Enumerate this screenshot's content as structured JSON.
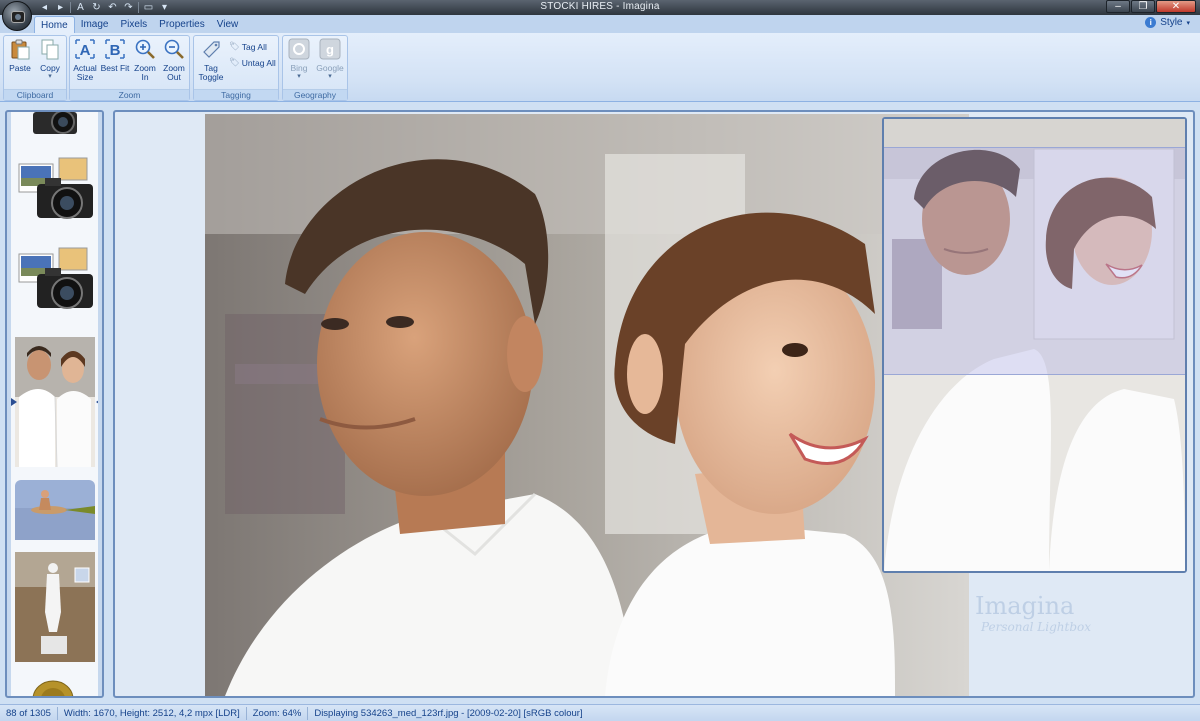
{
  "window": {
    "title": "STOCKI HIRES - Imagina"
  },
  "qat": {
    "icons": [
      "back-icon",
      "forward-icon",
      "text-a-icon",
      "rotate-cw-icon",
      "undo-icon",
      "redo-icon",
      "document-icon",
      "customize-icon"
    ]
  },
  "tabs": [
    {
      "label": "Home",
      "active": true
    },
    {
      "label": "Image",
      "active": false
    },
    {
      "label": "Pixels",
      "active": false
    },
    {
      "label": "Properties",
      "active": false
    },
    {
      "label": "View",
      "active": false
    }
  ],
  "style_menu": {
    "label": "Style"
  },
  "ribbon": {
    "clipboard": {
      "label": "Clipboard",
      "paste": "Paste",
      "copy": "Copy"
    },
    "zoom": {
      "label": "Zoom",
      "actual_size_line1": "Actual",
      "actual_size_line2": "Size",
      "best_fit": "Best Fit",
      "zoom_in_line1": "Zoom",
      "zoom_in_line2": "In",
      "zoom_out_line1": "Zoom",
      "zoom_out_line2": "Out"
    },
    "tagging": {
      "label": "Tagging",
      "tag_toggle_line1": "Tag",
      "tag_toggle_line2": "Toggle",
      "tag_all": "Tag All",
      "untag_all": "Untag All"
    },
    "geography": {
      "label": "Geography",
      "bing": "Bing",
      "google": "Google"
    }
  },
  "thumbnails": [
    {
      "name": "camera-icon-thumb"
    },
    {
      "name": "photo-camera-thumb"
    },
    {
      "name": "photo-camera-thumb-2"
    },
    {
      "name": "couple-thumb",
      "selected": true
    },
    {
      "name": "swimmer-thumb"
    },
    {
      "name": "statue-thumb"
    },
    {
      "name": "coin-thumb"
    }
  ],
  "watermark": {
    "title": "Imagina",
    "subtitle": "Personal Lightbox"
  },
  "status": {
    "index": "88 of 1305",
    "dimensions": "Width: 1670, Height: 2512, 4,2 mpx [LDR]",
    "zoom": "Zoom: 64%",
    "file": "Displaying 534263_med_123rf.jpg - [2009-02-20] [sRGB colour]"
  },
  "colors": {
    "accent": "#15428b",
    "ribbon_bg": "#dbe7f6",
    "frame": "#6d8ebd",
    "titlebar": "#3a424b"
  }
}
